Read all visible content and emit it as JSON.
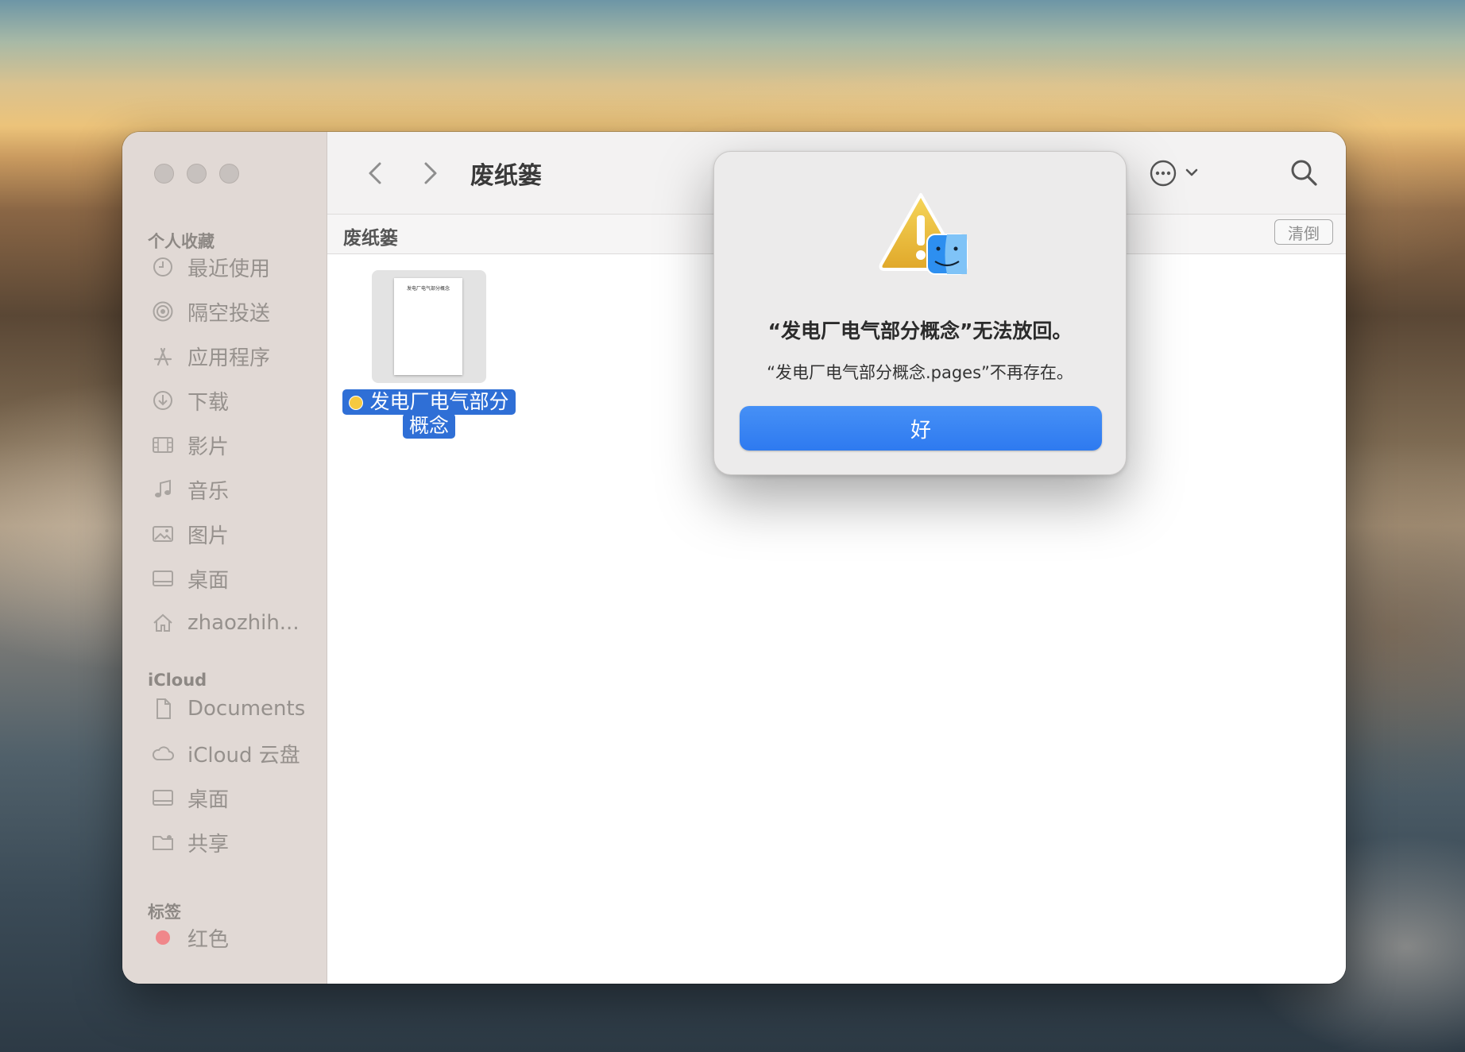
{
  "toolbar": {
    "title": "废纸篓"
  },
  "pathbar": {
    "title": "废纸篓",
    "empty_button": "清倒"
  },
  "sidebar": {
    "favorites_header": "个人收藏",
    "favorites": [
      {
        "label": "最近使用",
        "icon": "clock-icon"
      },
      {
        "label": "隔空投送",
        "icon": "airdrop-icon"
      },
      {
        "label": "应用程序",
        "icon": "apps-icon"
      },
      {
        "label": "下载",
        "icon": "download-icon"
      },
      {
        "label": "影片",
        "icon": "film-icon"
      },
      {
        "label": "音乐",
        "icon": "music-icon"
      },
      {
        "label": "图片",
        "icon": "photo-icon"
      },
      {
        "label": "桌面",
        "icon": "desktop-icon"
      },
      {
        "label": "zhaozhih...",
        "icon": "home-icon"
      }
    ],
    "icloud_header": "iCloud",
    "icloud": [
      {
        "label": "Documents",
        "icon": "document-icon"
      },
      {
        "label": "iCloud 云盘",
        "icon": "cloud-icon"
      },
      {
        "label": "桌面",
        "icon": "desktop-icon"
      },
      {
        "label": "共享",
        "icon": "shared-folder-icon"
      }
    ],
    "tags_header": "标签",
    "tags": [
      {
        "label": "红色",
        "color": "#f0878a"
      }
    ]
  },
  "file": {
    "name_line1": "发电厂电气部分",
    "name_line2": "概念",
    "thumb_title": "发电厂电气部分概念",
    "tag_color": "#f6c940"
  },
  "dialog": {
    "title": "“发电厂电气部分概念”无法放回。",
    "message": "“发电厂电气部分概念.pages”不再存在。",
    "ok_label": "好",
    "accent": "#2f7bf1"
  }
}
